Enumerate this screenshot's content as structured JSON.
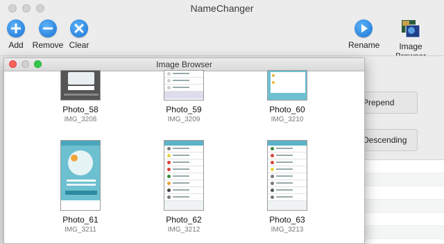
{
  "app": {
    "title": "NameChanger"
  },
  "toolbar": {
    "add_label": "Add",
    "remove_label": "Remove",
    "clear_label": "Clear",
    "rename_label": "Rename",
    "image_browser_label": "Image Browser"
  },
  "options": {
    "prepend_label": "Prepend",
    "descending_label": "Descending"
  },
  "image_browser": {
    "title": "Image Browser",
    "items": [
      {
        "photo": "Photo_58",
        "file": "IMG_3208"
      },
      {
        "photo": "Photo_59",
        "file": "IMG_3209"
      },
      {
        "photo": "Photo_60",
        "file": "IMG_3210"
      },
      {
        "photo": "Photo_61",
        "file": "IMG_3211"
      },
      {
        "photo": "Photo_62",
        "file": "IMG_3212"
      },
      {
        "photo": "Photo_63",
        "file": "IMG_3213"
      }
    ]
  },
  "colors": {
    "close": "#fc605c",
    "minimize": "#fdbc40",
    "zoom": "#34c84a",
    "accent": "#1a74d6"
  }
}
